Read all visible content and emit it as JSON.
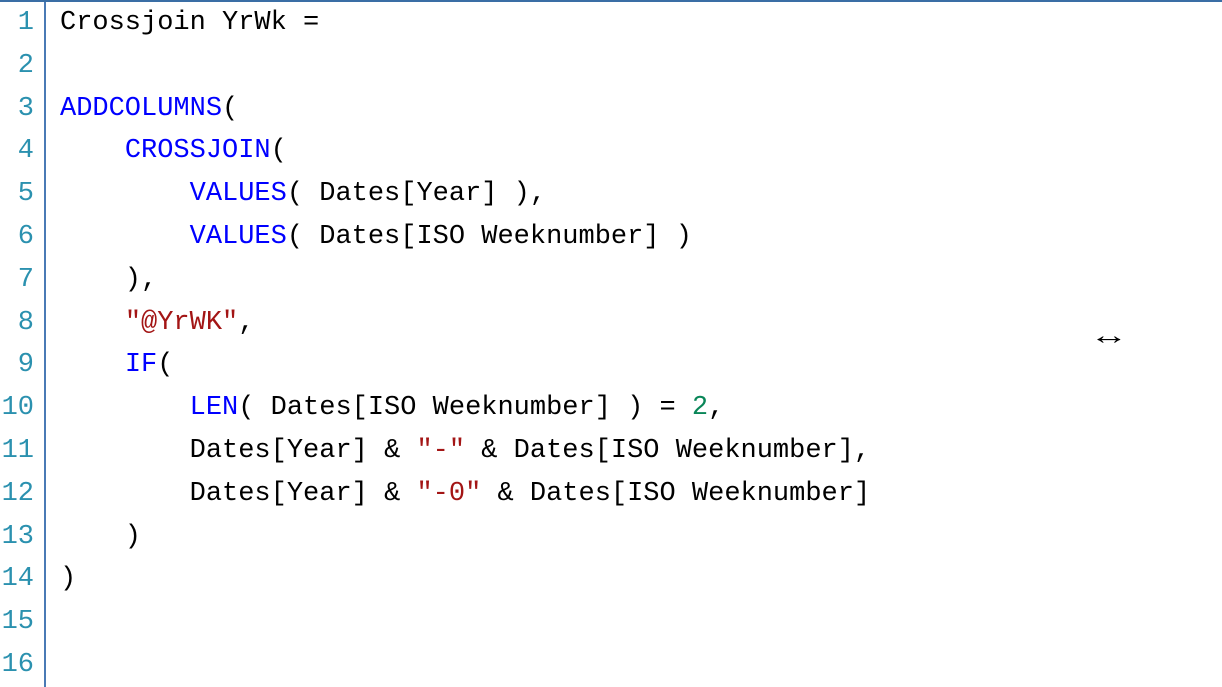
{
  "editor": {
    "line_numbers": [
      "1",
      "2",
      "3",
      "4",
      "5",
      "6",
      "7",
      "8",
      "9",
      "10",
      "11",
      "12",
      "13",
      "14",
      "15",
      "16"
    ],
    "lines": [
      [
        {
          "text": "Crossjoin YrWk ",
          "cls": "tok-identifier"
        },
        {
          "text": "=",
          "cls": "tok-operator"
        }
      ],
      [],
      [
        {
          "text": "ADDCOLUMNS",
          "cls": "tok-keyword"
        },
        {
          "text": "(",
          "cls": "tok-operator"
        }
      ],
      [
        {
          "text": "    ",
          "cls": "tok-identifier"
        },
        {
          "text": "CROSSJOIN",
          "cls": "tok-keyword"
        },
        {
          "text": "(",
          "cls": "tok-operator"
        }
      ],
      [
        {
          "text": "        ",
          "cls": "tok-identifier"
        },
        {
          "text": "VALUES",
          "cls": "tok-keyword"
        },
        {
          "text": "( Dates[Year] )",
          "cls": "tok-identifier"
        },
        {
          "text": ",",
          "cls": "tok-operator"
        }
      ],
      [
        {
          "text": "        ",
          "cls": "tok-identifier"
        },
        {
          "text": "VALUES",
          "cls": "tok-keyword"
        },
        {
          "text": "( Dates[ISO Weeknumber] )",
          "cls": "tok-identifier"
        }
      ],
      [
        {
          "text": "    )",
          "cls": "tok-identifier"
        },
        {
          "text": ",",
          "cls": "tok-operator"
        }
      ],
      [
        {
          "text": "    ",
          "cls": "tok-identifier"
        },
        {
          "text": "\"@YrWK\"",
          "cls": "tok-string"
        },
        {
          "text": ",",
          "cls": "tok-operator"
        }
      ],
      [
        {
          "text": "    ",
          "cls": "tok-identifier"
        },
        {
          "text": "IF",
          "cls": "tok-keyword"
        },
        {
          "text": "(",
          "cls": "tok-operator"
        }
      ],
      [
        {
          "text": "        ",
          "cls": "tok-identifier"
        },
        {
          "text": "LEN",
          "cls": "tok-keyword"
        },
        {
          "text": "( Dates[ISO Weeknumber] ) ",
          "cls": "tok-identifier"
        },
        {
          "text": "=",
          "cls": "tok-operator"
        },
        {
          "text": " ",
          "cls": "tok-identifier"
        },
        {
          "text": "2",
          "cls": "tok-number"
        },
        {
          "text": ",",
          "cls": "tok-operator"
        }
      ],
      [
        {
          "text": "        Dates[Year] ",
          "cls": "tok-identifier"
        },
        {
          "text": "&",
          "cls": "tok-operator"
        },
        {
          "text": " ",
          "cls": "tok-identifier"
        },
        {
          "text": "\"-\"",
          "cls": "tok-string"
        },
        {
          "text": " ",
          "cls": "tok-identifier"
        },
        {
          "text": "&",
          "cls": "tok-operator"
        },
        {
          "text": " Dates[ISO Weeknumber]",
          "cls": "tok-identifier"
        },
        {
          "text": ",",
          "cls": "tok-operator"
        }
      ],
      [
        {
          "text": "        Dates[Year] ",
          "cls": "tok-identifier"
        },
        {
          "text": "&",
          "cls": "tok-operator"
        },
        {
          "text": " ",
          "cls": "tok-identifier"
        },
        {
          "text": "\"-0\"",
          "cls": "tok-string"
        },
        {
          "text": " ",
          "cls": "tok-identifier"
        },
        {
          "text": "&",
          "cls": "tok-operator"
        },
        {
          "text": " Dates[ISO Weeknumber]",
          "cls": "tok-identifier"
        }
      ],
      [
        {
          "text": "    )",
          "cls": "tok-identifier"
        }
      ],
      [
        {
          "text": ")",
          "cls": "tok-identifier"
        }
      ],
      [],
      []
    ],
    "resize_glyph": "↔"
  }
}
